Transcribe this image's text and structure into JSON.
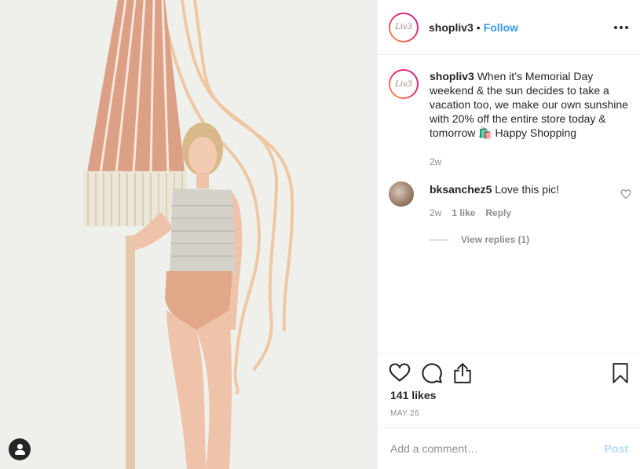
{
  "post": {
    "username": "shopliv3",
    "follow_label": "Follow",
    "separator": "•",
    "avatar_text": "Liv3",
    "caption": {
      "username": "shopliv3",
      "text": "When it’s Memorial Day weekend & the sun decides to take a vacation too, we make our own sunshine with 20% off the entire store today & tomorrow 🛍️  Happy Shopping",
      "time": "2w"
    },
    "comments": [
      {
        "username": "bksanchez5",
        "text": "Love this pic!",
        "time": "2w",
        "likes": "1 like",
        "reply_label": "Reply",
        "view_replies": "View replies (1)"
      }
    ],
    "likes": "141 likes",
    "date": "MAY 26",
    "add_comment_placeholder": "Add a comment…",
    "post_label": "Post"
  },
  "icons": {
    "more": "more-options-icon",
    "like": "heart-icon",
    "comment": "comment-icon",
    "share": "share-icon",
    "save": "bookmark-icon",
    "comment_like": "heart-outline-small-icon",
    "tagged_user": "user-tag-icon"
  },
  "colors": {
    "accent": "#3897f0",
    "post_disabled": "#b3dbff",
    "muted": "#8e8e8e"
  }
}
